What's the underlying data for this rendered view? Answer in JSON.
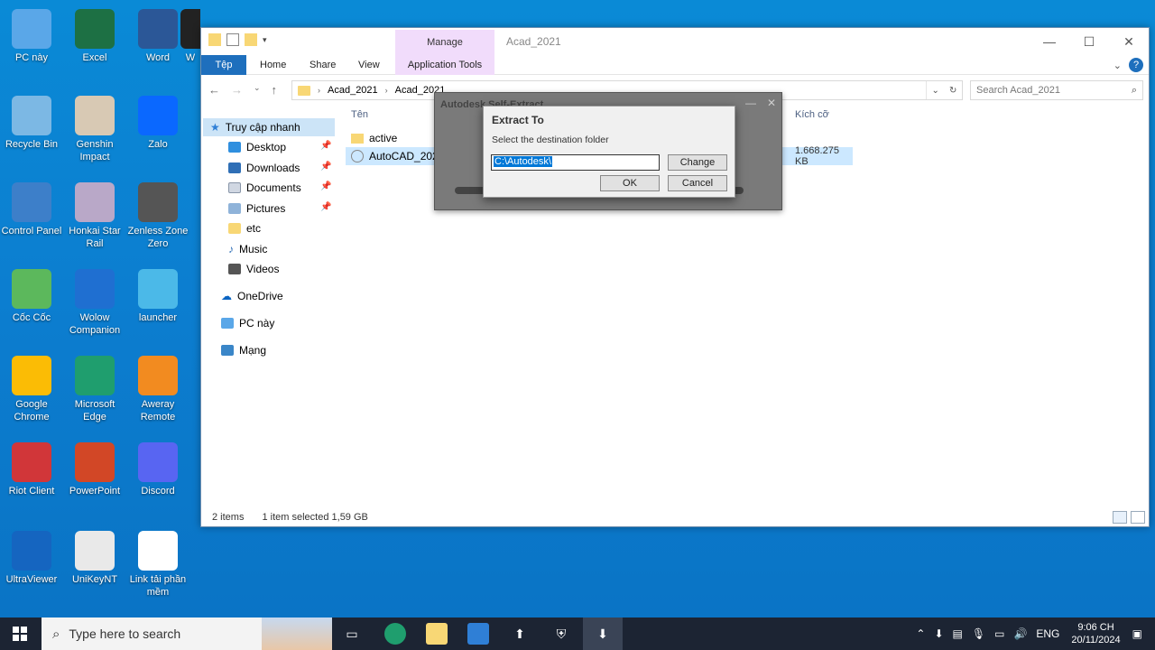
{
  "desktop": {
    "icons": [
      {
        "label": "PC này",
        "icon": "computer-icon",
        "color": "#5aa7e8"
      },
      {
        "label": "Excel",
        "icon": "excel-icon",
        "color": "#1d7044"
      },
      {
        "label": "Word",
        "icon": "word-icon",
        "color": "#2b5797"
      },
      {
        "label": "W",
        "icon": "app-icon",
        "color": "#222"
      },
      {
        "label": "Recycle Bin",
        "icon": "recycle-bin-icon",
        "color": "#7cb8e4"
      },
      {
        "label": "Genshin Impact",
        "icon": "genshin-icon",
        "color": "#d8c9b4"
      },
      {
        "label": "Zalo",
        "icon": "zalo-icon",
        "color": "#0a68ff"
      },
      {
        "label": "Control Panel",
        "icon": "control-panel-icon",
        "color": "#3d7fc9"
      },
      {
        "label": "Honkai Star Rail",
        "icon": "honkai-icon",
        "color": "#b9a8c8"
      },
      {
        "label": "Zenless Zone Zero",
        "icon": "zzz-icon",
        "color": "#555"
      },
      {
        "label": "Cốc Cốc",
        "icon": "coccoc-icon",
        "color": "#5cb85c"
      },
      {
        "label": "Wolow Companion",
        "icon": "wolow-icon",
        "color": "#1f6fd1"
      },
      {
        "label": "launcher",
        "icon": "launcher-icon",
        "color": "#4bb9e8"
      },
      {
        "label": "Google Chrome",
        "icon": "chrome-icon",
        "color": "#fbbc05"
      },
      {
        "label": "Microsoft Edge",
        "icon": "edge-icon",
        "color": "#1f9e6e"
      },
      {
        "label": "Aweray Remote",
        "icon": "aweray-icon",
        "color": "#f28b20"
      },
      {
        "label": "Riot Client",
        "icon": "riot-icon",
        "color": "#d13639"
      },
      {
        "label": "PowerPoint",
        "icon": "powerpoint-icon",
        "color": "#d24726"
      },
      {
        "label": "Discord",
        "icon": "discord-icon",
        "color": "#5865f2"
      },
      {
        "label": "UltraViewer",
        "icon": "ultraviewer-icon",
        "color": "#1565c0"
      },
      {
        "label": "UniKeyNT",
        "icon": "unikey-icon",
        "color": "#e9e9e9"
      },
      {
        "label": "Link tải phần mềm",
        "icon": "word-doc-icon",
        "color": "#ffffff"
      }
    ]
  },
  "explorer": {
    "manage_tab": "Manage",
    "title": "Acad_2021",
    "ribbon": {
      "file": "Tệp",
      "home": "Home",
      "share": "Share",
      "view": "View",
      "app_tools": "Application Tools"
    },
    "address": {
      "crumb1": "Acad_2021",
      "crumb2": "Acad_2021"
    },
    "search_placeholder": "Search Acad_2021",
    "nav": {
      "quick_access": "Truy cập nhanh",
      "desktop": "Desktop",
      "downloads": "Downloads",
      "documents": "Documents",
      "pictures": "Pictures",
      "etc": "etc",
      "music": "Music",
      "videos": "Videos",
      "onedrive": "OneDrive",
      "pc": "PC này",
      "network": "Mạng"
    },
    "columns": {
      "name": "Tên",
      "size": "Kích cỡ"
    },
    "files": [
      {
        "name": "active",
        "size": ""
      },
      {
        "name": "AutoCAD_2021",
        "size": "1.668.275 KB"
      }
    ],
    "status": {
      "count": "2 items",
      "selected": "1 item selected",
      "selected_size": "1,59 GB"
    }
  },
  "sfx_dialog": {
    "title": "Autodesk Self-Extract"
  },
  "extract_dialog": {
    "title": "Extract To",
    "label": "Select the destination folder",
    "path": "C:\\Autodesk\\",
    "change": "Change",
    "ok": "OK",
    "cancel": "Cancel"
  },
  "taskbar": {
    "search_placeholder": "Type here to search",
    "lang": "ENG",
    "time": "9:06 CH",
    "date": "20/11/2024"
  }
}
